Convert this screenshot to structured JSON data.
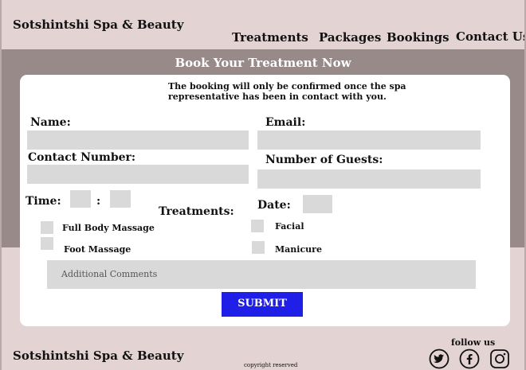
{
  "header": {
    "brand": "Sotshintshi Spa & Beauty",
    "nav": [
      "Treatments",
      "Packages",
      "Bookings",
      "Contact Us"
    ]
  },
  "booking": {
    "title": "Book Your Treatment Now",
    "notice": "The booking will only be confirmed once the spa representative has been in contact with you.",
    "labels": {
      "name": "Name:",
      "email": "Email:",
      "contact": "Contact Number:",
      "guests": "Number of Guests:",
      "time": "Time:",
      "time_sep": ":",
      "treatments": "Treatments:",
      "date": "Date:"
    },
    "options": {
      "full_body_massage": "Full Body Massage",
      "foot_massage": "Foot Massage",
      "facial": "Facial",
      "manicure": "Manicure"
    },
    "comments_placeholder": "Additional Comments",
    "submit": "SUBMIT"
  },
  "footer": {
    "brand": "Sotshintshi Spa & Beauty",
    "copyright": "copyright reserved",
    "follow": "follow us",
    "social": [
      "twitter-icon",
      "facebook-icon",
      "instagram-icon"
    ]
  },
  "colors": {
    "background": "#e3d3d3",
    "band": "#978a89",
    "field": "#d9d9d9",
    "submit": "#1f1fe8"
  }
}
